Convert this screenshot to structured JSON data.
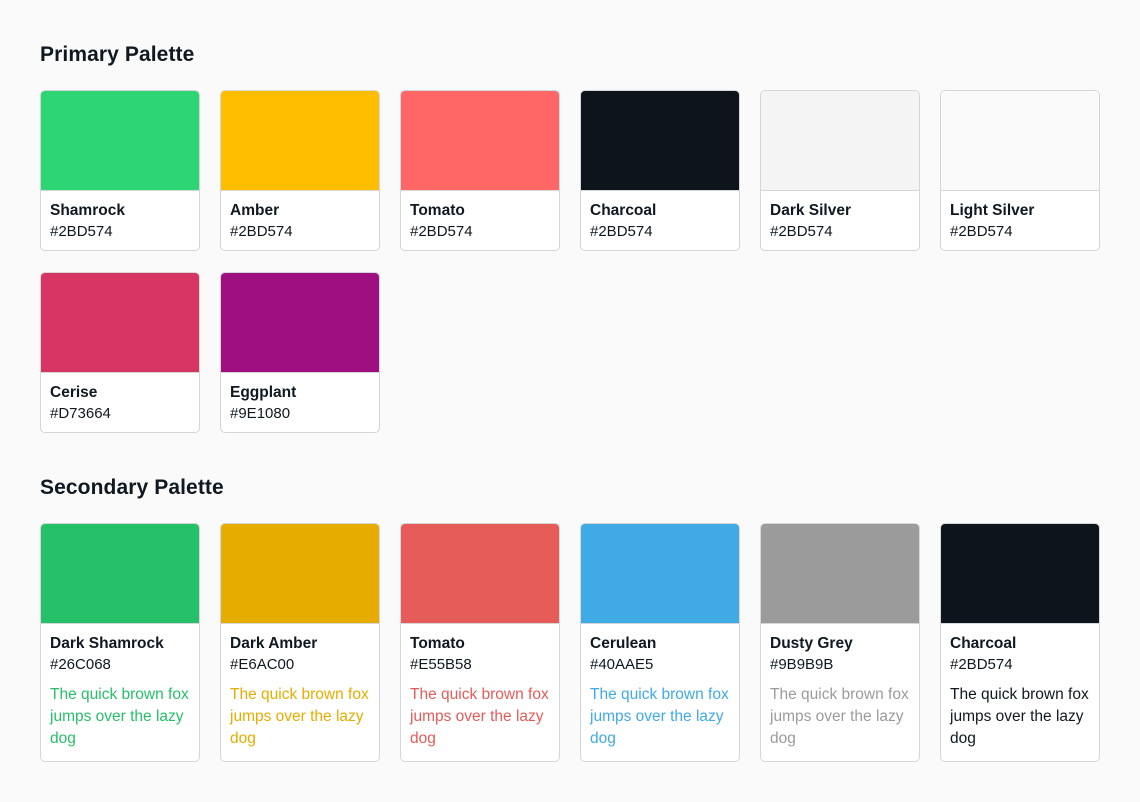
{
  "primary": {
    "title": "Primary Palette",
    "colors": [
      {
        "name": "Shamrock",
        "hex_label": "#2BD574",
        "swatch": "#2DD574"
      },
      {
        "name": "Amber",
        "hex_label": "#2BD574",
        "swatch": "#FFBE00"
      },
      {
        "name": "Tomato",
        "hex_label": "#2BD574",
        "swatch": "#FF6666"
      },
      {
        "name": "Charcoal",
        "hex_label": "#2BD574",
        "swatch": "#0D141C"
      },
      {
        "name": "Dark Silver",
        "hex_label": "#2BD574",
        "swatch": "#F4F4F4"
      },
      {
        "name": "Light Silver",
        "hex_label": "#2BD574",
        "swatch": "#FAFAFA"
      },
      {
        "name": "Cerise",
        "hex_label": "#D73664",
        "swatch": "#D73664"
      },
      {
        "name": "Eggplant",
        "hex_label": "#9E1080",
        "swatch": "#9E1080"
      }
    ]
  },
  "secondary": {
    "title": "Secondary Palette",
    "sample_text": "The quick brown fox jumps over the lazy dog",
    "colors": [
      {
        "name": "Dark Shamrock",
        "hex_label": "#26C068",
        "swatch": "#26C068",
        "text_color": "#26C068"
      },
      {
        "name": "Dark Amber",
        "hex_label": "#E6AC00",
        "swatch": "#E6AC00",
        "text_color": "#E6AC00"
      },
      {
        "name": "Tomato",
        "hex_label": "#E55B58",
        "swatch": "#E55B58",
        "text_color": "#E55B58"
      },
      {
        "name": "Cerulean",
        "hex_label": "#40AAE5",
        "swatch": "#40AAE5",
        "text_color": "#40AAE5"
      },
      {
        "name": "Dusty Grey",
        "hex_label": "#9B9B9B",
        "swatch": "#9B9B9B",
        "text_color": "#9B9B9B"
      },
      {
        "name": "Charcoal",
        "hex_label": "#2BD574",
        "swatch": "#0D141C",
        "text_color": "#101820"
      }
    ]
  }
}
